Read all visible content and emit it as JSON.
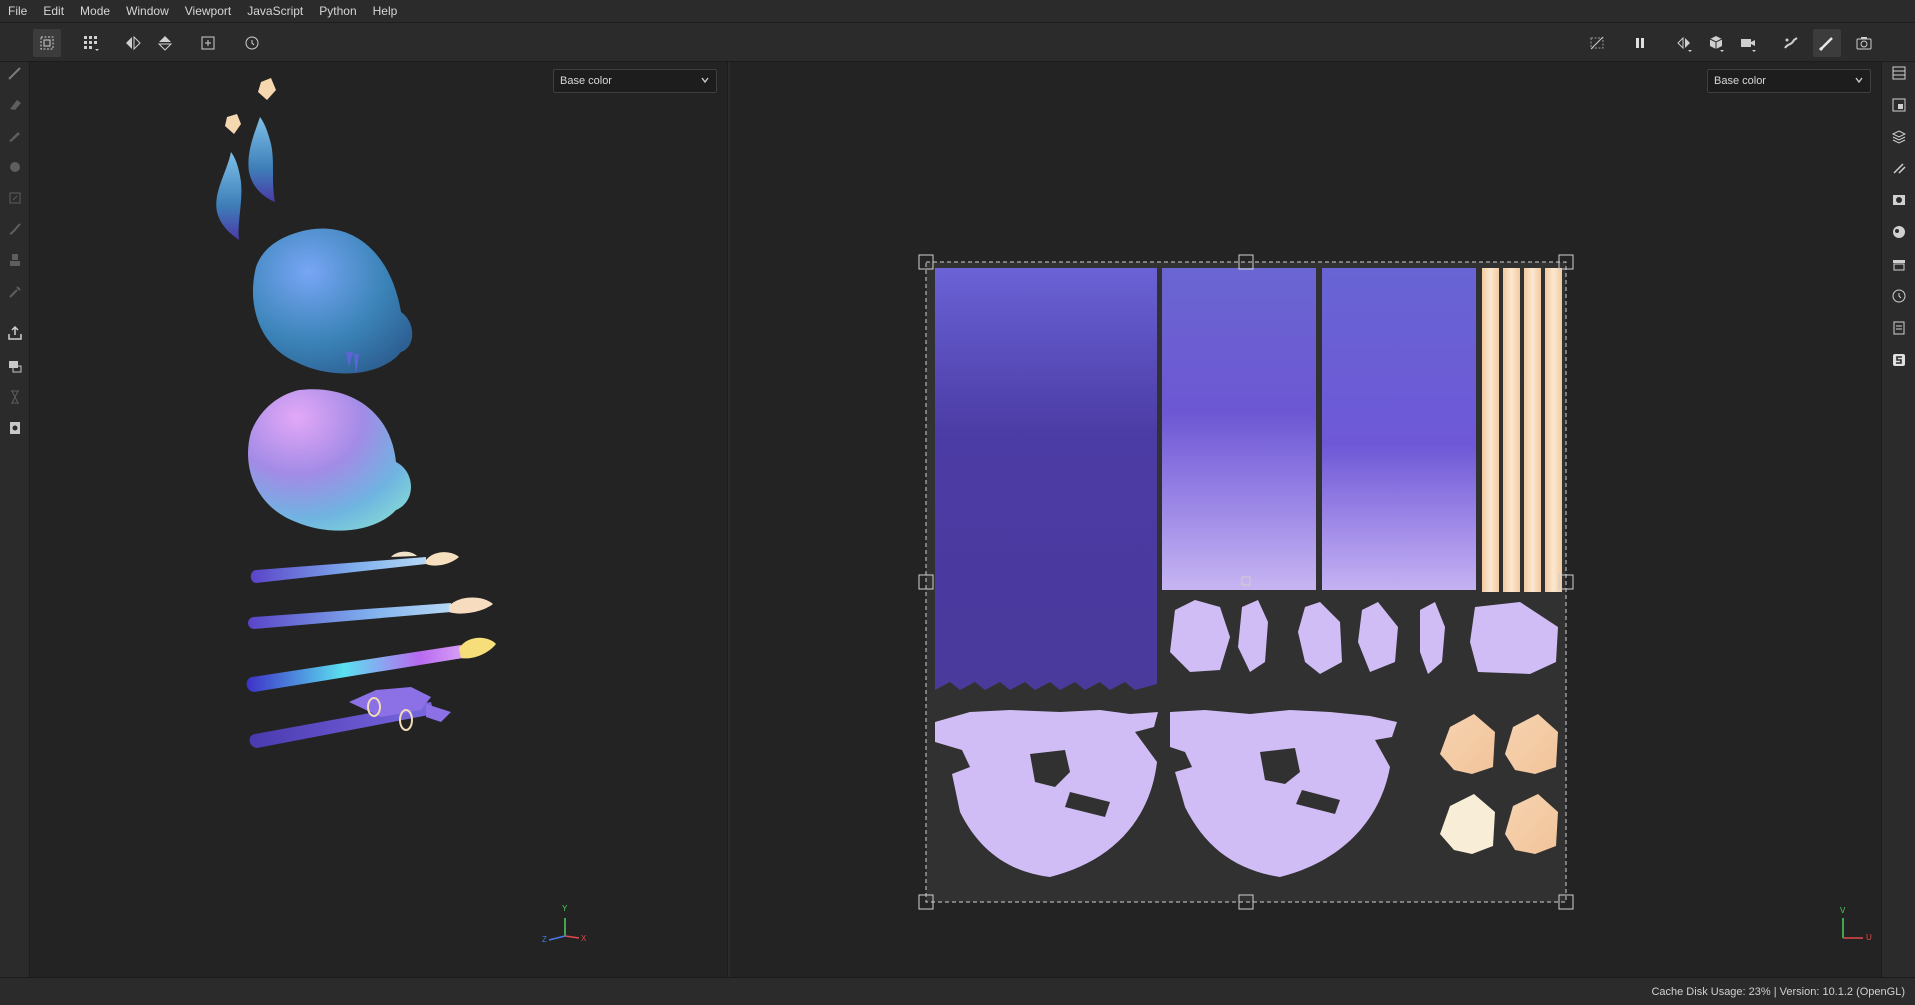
{
  "menu": [
    "File",
    "Edit",
    "Mode",
    "Window",
    "Viewport",
    "JavaScript",
    "Python",
    "Help"
  ],
  "toolbar": {
    "left_icons": [
      "uv-select-icon",
      "grid-dropdown-icon",
      "flip-horizontal-icon",
      "flip-vertical-icon",
      "add-frame-icon",
      "reset-view-icon"
    ],
    "right_icons": [
      "hide-icon",
      "pause-icon",
      "symmetry-dropdown-icon",
      "cube-dropdown-icon",
      "camera-dropdown-icon",
      "bake-icon",
      "paint-mode-icon",
      "screenshot-icon"
    ]
  },
  "left_tools": [
    "brush-icon",
    "eraser-icon",
    "projection-icon",
    "geometry-mask-icon",
    "polygon-fill-icon",
    "smudge-icon",
    "clone-icon",
    "color-picker-icon",
    "export-dropdown-icon",
    "bake-tool-icon",
    "hourglass-icon",
    "document-icon"
  ],
  "right_panels": [
    "layers-stack-icon",
    "texture-set-settings-icon",
    "layers-icon",
    "properties-icon",
    "display-settings-icon",
    "shelf-icon",
    "assets-icon",
    "history-icon",
    "log-icon",
    "substance-icon"
  ],
  "viewport3d": {
    "channel": "Base color"
  },
  "viewport2d": {
    "channel": "Base color"
  },
  "axis": {
    "x": "X",
    "y": "Y",
    "z": "Z",
    "u": "U",
    "v": "V"
  },
  "status": {
    "text": "Cache Disk Usage:   23% | Version: 10.1.2 (OpenGL)"
  },
  "colors": {
    "purple_dark": "#4a3a9c",
    "purple_mid": "#6f63d6",
    "lilac": "#d1bdf5",
    "peach": "#f5cba6",
    "cream": "#f8eed8",
    "blue": "#5f8fe8"
  }
}
